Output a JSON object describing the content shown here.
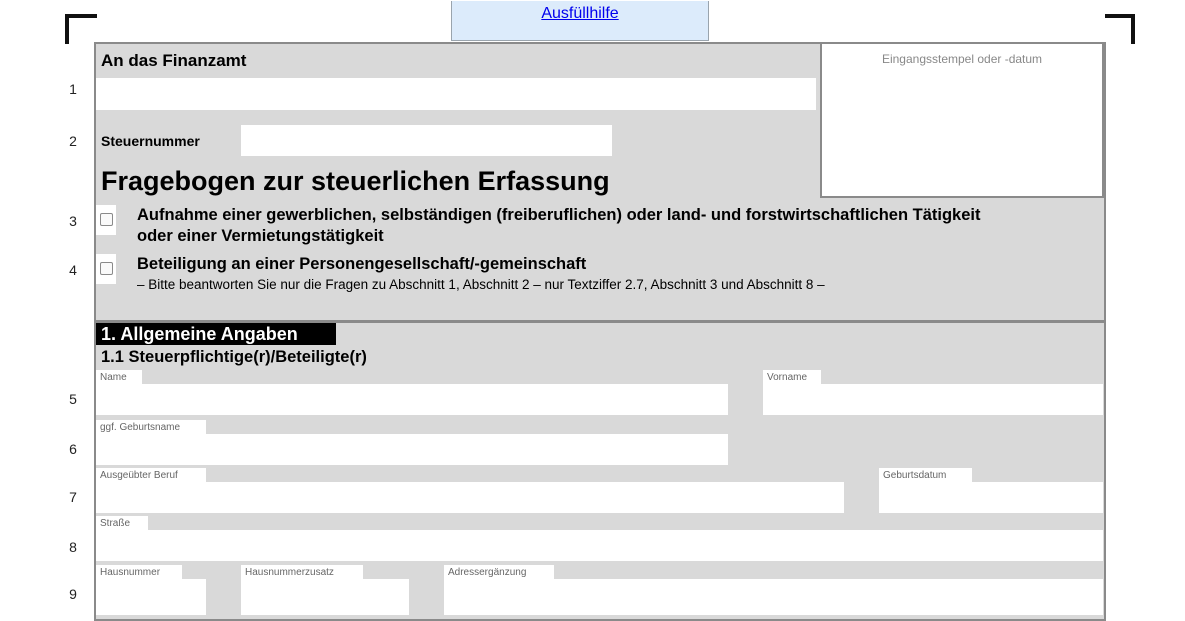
{
  "help_link": "Ausfüllhilfe",
  "header": {
    "finanzamt_label": "An das Finanzamt",
    "stamp_label": "Eingangsstempel oder -datum",
    "steuernummer_label": "Steuernummer",
    "form_title": "Fragebogen zur steuerlichen Erfassung"
  },
  "rows": {
    "r1": "1",
    "r2": "2",
    "r3": "3",
    "r4": "4",
    "r5": "5",
    "r6": "6",
    "r7": "7",
    "r8": "8",
    "r9": "9"
  },
  "options": {
    "opt3_line1": "Aufnahme einer gewerblichen, selbständigen (freiberuflichen) oder land- und forstwirtschaftlichen Tätigkeit",
    "opt3_line2": "oder einer Vermietungstätigkeit",
    "opt4_title": "Beteiligung an einer Personengesellschaft/-gemeinschaft",
    "opt4_note": "– Bitte beantworten Sie nur die Fragen zu Abschnitt 1, Abschnitt 2 – nur Textziffer 2.7, Abschnitt 3 und Abschnitt 8 –"
  },
  "section1": {
    "title": "1. Allgemeine Angaben",
    "subtitle": "1.1 Steuerpflichtige(r)/Beteiligte(r)",
    "fields": {
      "name": "Name",
      "vorname": "Vorname",
      "geburtsname": "ggf. Geburtsname",
      "beruf": "Ausgeübter Beruf",
      "geburtsdatum": "Geburtsdatum",
      "strasse": "Straße",
      "hausnummer": "Hausnummer",
      "hausnummerzusatz": "Hausnummerzusatz",
      "adresserganzung": "Adressergänzung"
    }
  }
}
